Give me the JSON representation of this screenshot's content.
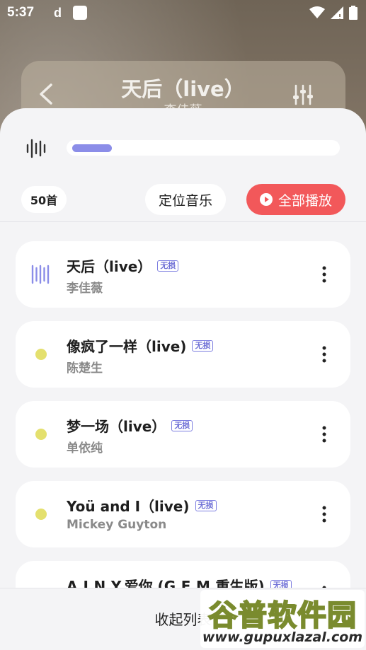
{
  "status_bar": {
    "time": "5:37",
    "app_glyph": "d"
  },
  "player": {
    "title": "天后（live）",
    "artist": "李佳薇"
  },
  "sheet": {
    "progress_fraction": 0.15,
    "count_label": "50首",
    "locate_label": "定位音乐",
    "play_all_label": "全部播放",
    "collapse_label": "收起列表"
  },
  "songs": [
    {
      "title": "天后（live）",
      "badge": "无损",
      "artist": "李佳薇",
      "playing": true
    },
    {
      "title": "像疯了一样（live)",
      "badge": "无损",
      "artist": "陈楚生",
      "playing": false
    },
    {
      "title": "梦一场（live）",
      "badge": "无损",
      "artist": "单依纯",
      "playing": false
    },
    {
      "title": "Yoü and I（live)",
      "badge": "无损",
      "artist": "Mickey Guyton",
      "playing": false
    },
    {
      "title": "A.I.N.Y.爱你 (G.E.M.重生版)",
      "badge": "无损",
      "artist": "",
      "playing": false
    }
  ],
  "watermark": {
    "title": "谷普软件园",
    "url": "www.gupuxlazal.com"
  },
  "colors": {
    "accent_purple": "#8b8de8",
    "play_all_red": "#f2585a",
    "dot_yellow": "#e4e06e",
    "sheet_bg": "#f4f4f6"
  },
  "icons": [
    "back-icon",
    "equalizer-icon",
    "waveform-icon",
    "playing-bars-icon",
    "more-vert-icon",
    "play-circle-icon",
    "wifi-icon",
    "signal-icon",
    "battery-icon"
  ]
}
